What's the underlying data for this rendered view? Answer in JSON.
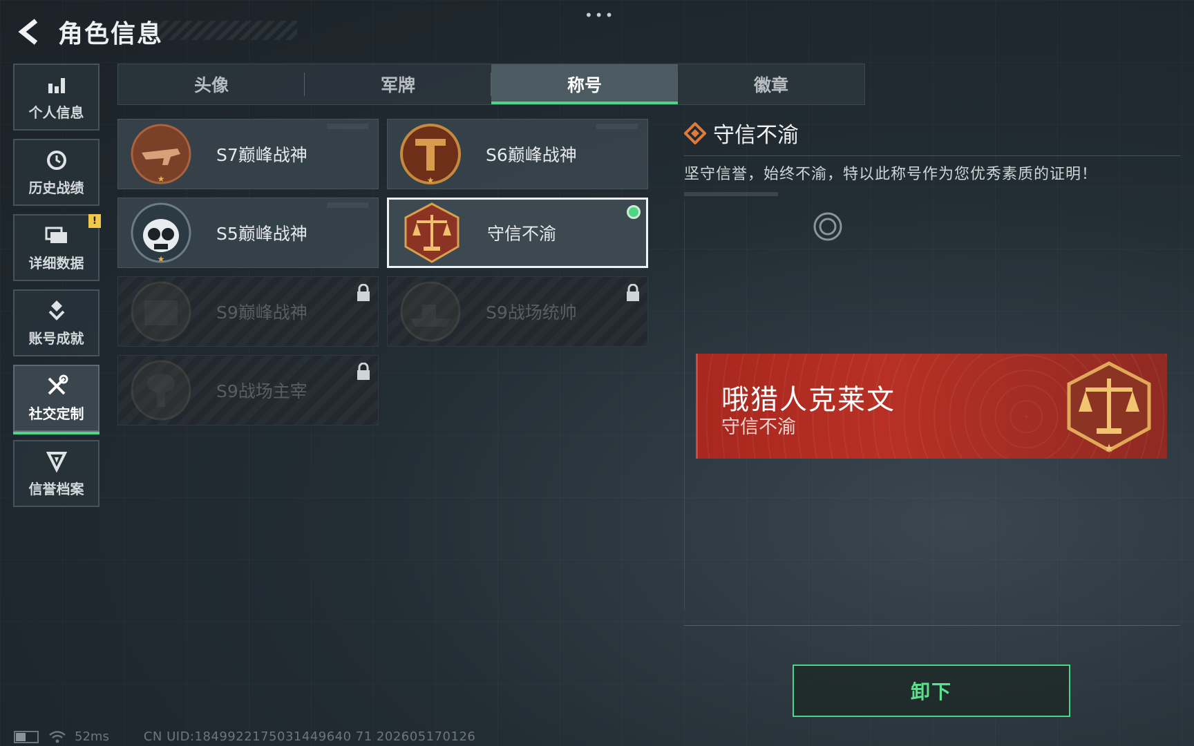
{
  "header": {
    "title": "角色信息",
    "more": "•••"
  },
  "sidebar": {
    "items": [
      {
        "label": "个人信息",
        "icon": "bar-chart-icon"
      },
      {
        "label": "历史战绩",
        "icon": "history-icon"
      },
      {
        "label": "详细数据",
        "icon": "folder-icon",
        "badge": "!"
      },
      {
        "label": "账号成就",
        "icon": "achievement-icon"
      },
      {
        "label": "社交定制",
        "icon": "tools-icon",
        "active": true
      },
      {
        "label": "信誉档案",
        "icon": "reputation-icon"
      }
    ]
  },
  "tabs": [
    {
      "label": "头像"
    },
    {
      "label": "军牌"
    },
    {
      "label": "称号",
      "active": true
    },
    {
      "label": "徽章"
    }
  ],
  "titles": [
    {
      "label": "S7巅峰战神",
      "state": "unlocked",
      "emblem_color": "#8a4a2a"
    },
    {
      "label": "S6巅峰战神",
      "state": "unlocked",
      "emblem_color": "#7a3a1e"
    },
    {
      "label": "S5巅峰战神",
      "state": "unlocked",
      "emblem_color": "#3a4a55"
    },
    {
      "label": "守信不渝",
      "state": "selected",
      "emblem_color": "#8c3424"
    },
    {
      "label": "S9巅峰战神",
      "state": "locked",
      "emblem_color": "#4a4a44"
    },
    {
      "label": "S9战场统帅",
      "state": "locked",
      "emblem_color": "#4a4a44"
    },
    {
      "label": "S9战场主宰",
      "state": "locked",
      "emblem_color": "#4a4a44"
    }
  ],
  "detail": {
    "title": "守信不渝",
    "description": "坚守信誉，始终不渝，特以此称号作为您优秀素质的证明！"
  },
  "banner": {
    "player_name": "哦猎人克莱文",
    "title": "守信不渝",
    "color": "#a8271e"
  },
  "action": {
    "unequip_label": "卸下"
  },
  "status": {
    "ping": "52ms",
    "uid": "CN UID:1849922175031449640 71 202605170126"
  },
  "colors": {
    "accent": "#4fd684",
    "warning": "#f1c84a"
  }
}
